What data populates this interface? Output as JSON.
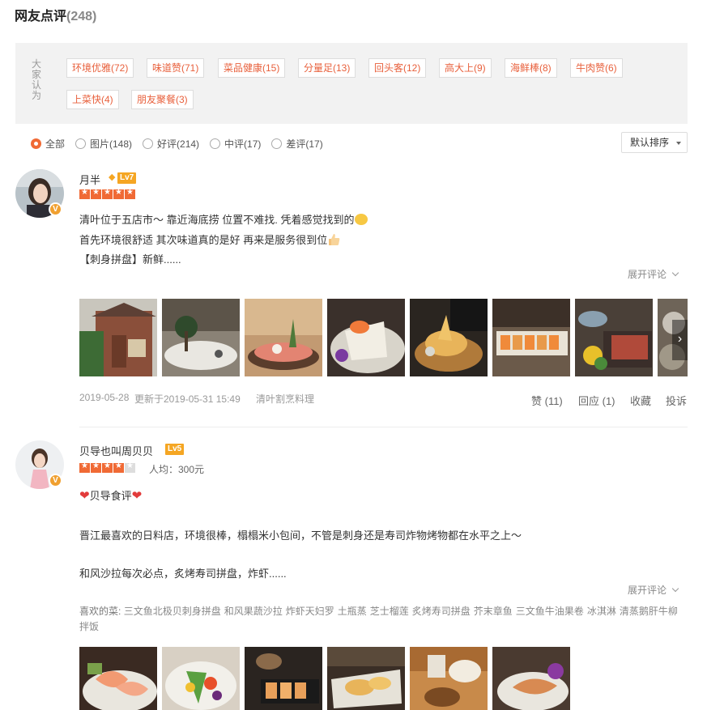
{
  "header": {
    "title": "网友点评",
    "count": "(248)"
  },
  "tagbox": {
    "label": "大家认为",
    "tags": [
      "环境优雅(72)",
      "味道赞(71)",
      "菜品健康(15)",
      "分量足(13)",
      "回头客(12)",
      "高大上(9)",
      "海鲜棒(8)",
      "牛肉赞(6)",
      "上菜快(4)",
      "朋友聚餐(3)"
    ]
  },
  "filters": {
    "items": [
      "全部",
      "图片(148)",
      "好评(214)",
      "中评(17)",
      "差评(17)"
    ],
    "selected": "全部"
  },
  "sort": {
    "label": "默认排序"
  },
  "reviews": [
    {
      "user": "月半",
      "level": "Lv7",
      "rating": 5,
      "lines": [
        "清叶位于五店市～ 靠近海底捞 位置不难找. 凭着感觉找到的",
        "首先环境很舒适 其次味道真的是好 再来是服务很到位",
        "【刺身拼盘】新鲜......"
      ],
      "expand": "展开评论",
      "created": "2019-05-28",
      "updated": "更新于2019-05-31 15:49",
      "shop": "清叶割烹料理",
      "actions": [
        "赞 (11)",
        "回应 (1)",
        "收藏",
        "投诉"
      ],
      "photo_count": 8
    },
    {
      "user": "贝导也叫周贝贝",
      "level": "Lv5",
      "rating": 4,
      "avg_price": "人均：300元",
      "lines": [
        "贝导食评",
        "晋江最喜欢的日料店，环境很棒，榻榻米小包间，不管是刺身还是寿司炸物烤物都在水平之上～",
        "和风沙拉每次必点，炙烤寿司拼盘，炸虾......"
      ],
      "expand": "展开评论",
      "dishes_label": "喜欢的菜:",
      "dishes": [
        "三文鱼北极贝刺身拼盘",
        "和风果蔬沙拉",
        "炸虾天妇罗",
        "土瓶蒸",
        "芝士榴莲",
        "炙烤寿司拼盘",
        "芥末章鱼",
        "三文鱼牛油果卷",
        "冰淇淋",
        "清蒸鹅肝牛柳拌饭"
      ],
      "photo_count": 6
    }
  ],
  "colors": {
    "accent": "#f06a35",
    "tag_text": "#e8603c",
    "level_badge": "#f5a623"
  }
}
